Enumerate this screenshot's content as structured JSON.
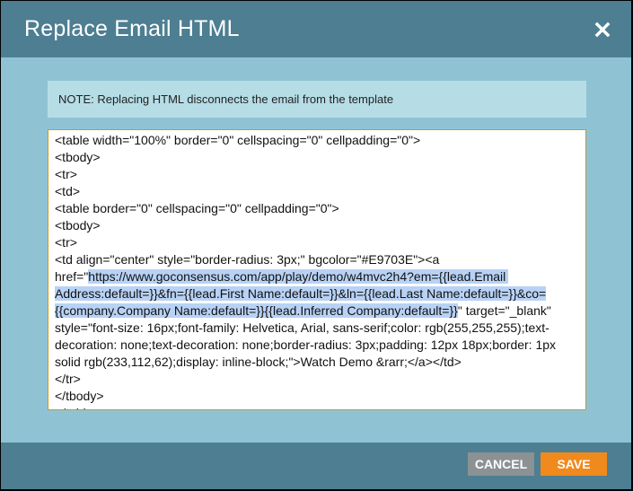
{
  "dialog": {
    "title": "Replace Email HTML",
    "close_icon": "close-icon",
    "note": "NOTE:  Replacing HTML disconnects the email from the template",
    "code_lines": [
      "<table width=\"100%\" border=\"0\" cellspacing=\"0\" cellpadding=\"0\">",
      "<tbody>",
      "<tr>",
      "<td>",
      "<table border=\"0\" cellspacing=\"0\" cellpadding=\"0\">",
      "<tbody>",
      "<tr>",
      "<td align=\"center\" style=\"border-radius: 3px;\" bgcolor=\"#E9703E\"><a href=\"https://www.goconsensus.com/app/play/demo/w4mvc2h4?em={{lead.Email Address:default=}}&fn={{lead.First Name:default=}}&ln={{lead.Last Name:default=}}&co={{company.Company Name:default=}}{{lead.Inferred Company:default=}}\" target=\"_blank\" style=\"font-size: 16px;font-family: Helvetica, Arial, sans-serif;color: rgb(255,255,255);text-decoration: none;text-decoration: none;border-radius: 3px;padding: 12px 18px;border: 1px solid rgb(233,112,62);display: inline-block;\">Watch Demo &rarr;</a></td>",
      "</tr>",
      "</tbody>",
      "</table>"
    ],
    "selected_text": "https://www.goconsensus.com/app/play/demo/w4mvc2h4?em={{lead.Email Address:default=}}&fn={{lead.First Name:default=}}&ln={{lead.Last Name:default=}}&co={{company.Company Name:default=}}{{lead.Inferred Company:default=}}",
    "cancel_label": "CANCEL",
    "save_label": "SAVE"
  },
  "colors": {
    "header": "#4d7e91",
    "body": "#8fc3d3",
    "note_bg": "#b6dde6",
    "editor_border": "#c79a2a",
    "selection": "#b8d2f5",
    "cancel": "#8c9194",
    "save": "#f18a1c"
  }
}
